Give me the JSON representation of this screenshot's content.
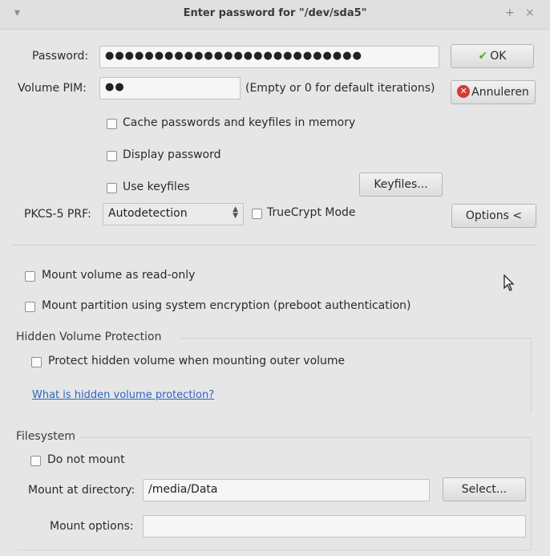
{
  "window": {
    "title": "Enter password for \"/dev/sda5\"",
    "menu_glyph": "▾",
    "pin_glyph": "+",
    "close_glyph": "×"
  },
  "password": {
    "label": "Password:",
    "value": "●●●●●●●●●●●●●●●●●●●●●●●●●●"
  },
  "pim": {
    "label": "Volume PIM:",
    "value": "●●",
    "hint": "(Empty or 0 for default iterations)"
  },
  "buttons": {
    "ok": "OK",
    "cancel": "Annuleren",
    "keyfiles": "Keyfiles...",
    "options": "Options <",
    "select": "Select..."
  },
  "checkboxes": {
    "cache": "Cache passwords and keyfiles in memory",
    "display": "Display password",
    "use_keyfiles": "Use keyfiles",
    "truecrypt": "TrueCrypt Mode",
    "readonly": "Mount volume as read-only",
    "sysenc": "Mount partition using system encryption (preboot authentication)",
    "protect_hidden": "Protect hidden volume when mounting outer volume",
    "do_not_mount": "Do not mount"
  },
  "prf": {
    "label": "PKCS-5 PRF:",
    "value": "Autodetection"
  },
  "hidden": {
    "title": "Hidden Volume Protection",
    "link": "What is hidden volume protection?"
  },
  "filesystem": {
    "title": "Filesystem",
    "dir_label": "Mount at directory:",
    "dir_value": "/media/Data",
    "opts_label": "Mount options:",
    "opts_value": ""
  },
  "icons": {
    "ok": "checkmark-icon",
    "cancel": "red-x-icon",
    "cursor": "mouse-pointer-icon"
  }
}
